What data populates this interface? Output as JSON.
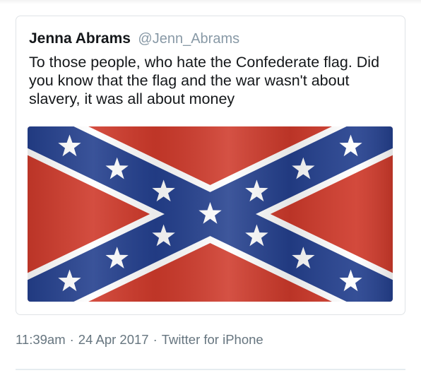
{
  "tweet": {
    "display_name": "Jenna Abrams",
    "handle": "@Jenn_Abrams",
    "text": "To those people, who hate the Confederate flag. Did you know that the flag and the war wasn't about slavery, it was all about money",
    "media": {
      "description_icon": "confederate-battle-flag",
      "colors": {
        "field": "#cf3a2b",
        "saltire": "#24408e",
        "border": "#ffffff",
        "stars": "#ffffff"
      },
      "star_count": 13
    }
  },
  "meta": {
    "time": "11:39am",
    "separator": "·",
    "date": "24 Apr 2017",
    "client": "Twitter for iPhone"
  }
}
